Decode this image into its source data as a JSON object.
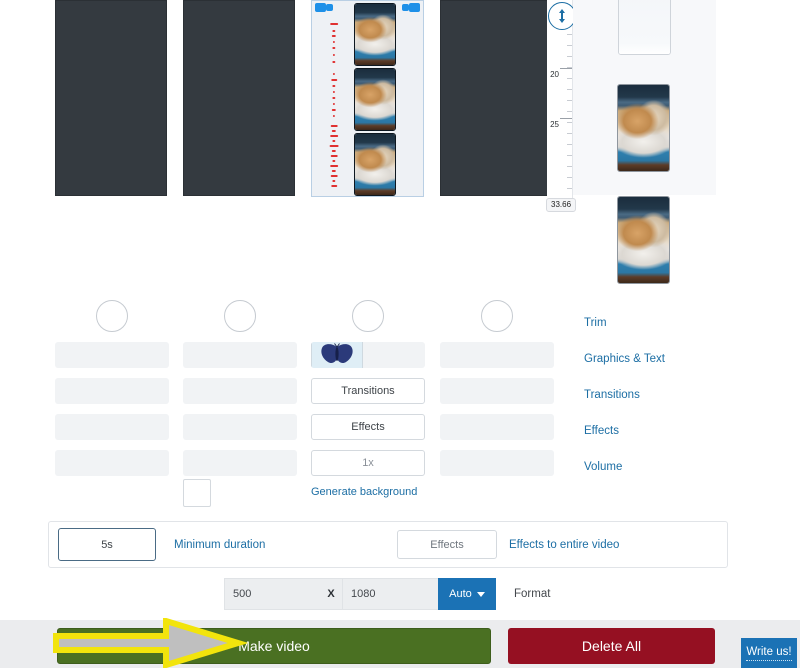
{
  "timeline": {
    "clips": [
      {
        "id": "clip-1",
        "type": "dark"
      },
      {
        "id": "clip-2",
        "type": "dark"
      },
      {
        "id": "clip-3",
        "type": "selected-media"
      },
      {
        "id": "clip-4",
        "type": "dark"
      }
    ],
    "selected_clip_index": 3,
    "ruler": {
      "labels": [
        "20",
        "25"
      ],
      "time_badge": "33.66"
    },
    "resize_button_icon": "vertical-resize-icon"
  },
  "columns": [
    {
      "index": 1,
      "circle": true,
      "rows": [
        "",
        "",
        "",
        ""
      ]
    },
    {
      "index": 2,
      "circle": true,
      "rows": [
        "",
        "",
        "",
        ""
      ]
    },
    {
      "index": 3,
      "circle": true,
      "thumbnail": "butterfly-thumbnail",
      "buttons": [
        "Transitions",
        "Effects",
        "1x"
      ],
      "link": "Generate background"
    },
    {
      "index": 4,
      "circle": true,
      "rows": [
        "",
        "",
        "",
        ""
      ]
    }
  ],
  "right_menu": {
    "items": [
      {
        "label": "Trim",
        "name": "menu-item-trim"
      },
      {
        "label": "Graphics & Text",
        "name": "menu-item-graphics-text"
      },
      {
        "label": "Transitions",
        "name": "menu-item-transitions"
      },
      {
        "label": "Effects",
        "name": "menu-item-effects"
      },
      {
        "label": "Volume",
        "name": "menu-item-volume"
      }
    ]
  },
  "duration_bar": {
    "duration_value": "5s",
    "duration_label": "Minimum duration",
    "effects_button": "Effects",
    "effects_label": "Effects to entire video"
  },
  "format_row": {
    "width_value": "500",
    "separator": "X",
    "height_value": "1080",
    "auto_label": "Auto",
    "format_label": "Format"
  },
  "actions": {
    "make_video": "Make video",
    "delete_all": "Delete All",
    "write_us": "Write us!"
  },
  "colors": {
    "make_video_green": "#4a7022",
    "delete_red": "#951022",
    "accent_blue": "#1b72b5",
    "link_blue": "#1c6ea4",
    "clip_dark": "#343a40",
    "arrow_yellow": "#f2e40c",
    "arrow_gray": "#bfbfbf"
  }
}
